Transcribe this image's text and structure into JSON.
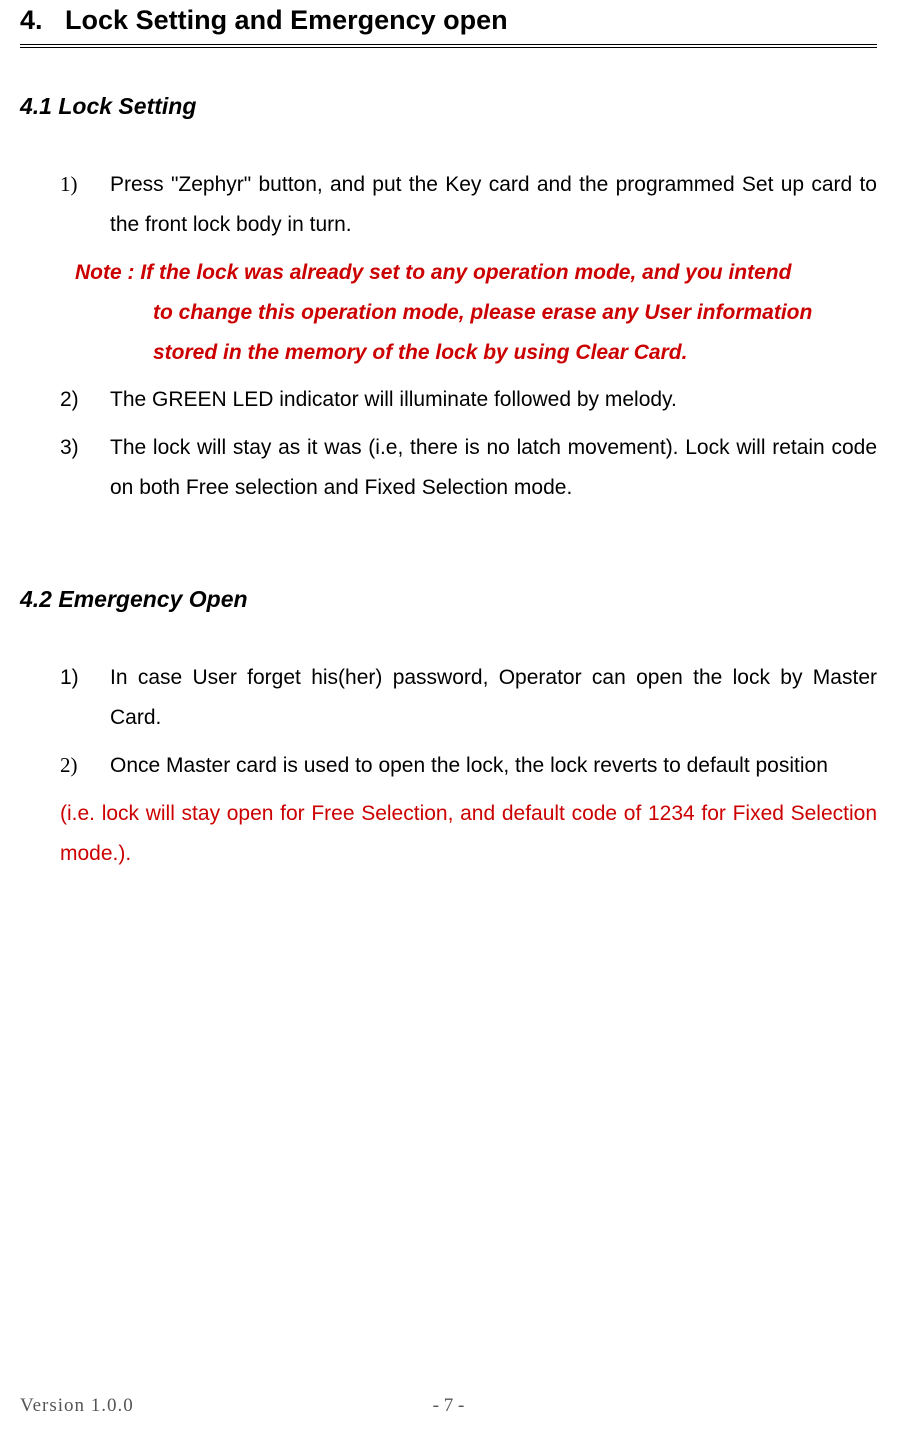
{
  "chapter": {
    "number": "4.",
    "title": "Lock Setting and Emergency open"
  },
  "section_41": {
    "title": "4.1 Lock Setting",
    "item1_num": "1)",
    "item1_text": "Press \"Zephyr\" button, and put the Key card and the programmed Set up card to the front lock body in turn.",
    "note_label": "Note : ",
    "note_line1": "If the lock was already set to any operation mode, and you intend",
    "note_line2": "to change this operation mode, please erase any User information",
    "note_line3": "stored in the memory of the lock by using Clear Card.",
    "item2_num": "2)",
    "item2_text": "The GREEN LED indicator will illuminate followed by melody.",
    "item3_num": "3)",
    "item3_text": "The lock will stay as it was (i.e, there is no latch movement). Lock will retain code on both Free selection and Fixed Selection mode."
  },
  "section_42": {
    "title": "4.2 Emergency Open",
    "item1_num": "1)",
    "item1_text": "In case User forget his(her) password, Operator can open the lock by Master Card.",
    "item2_num": "2)",
    "item2_text": "Once Master card is used to open the lock, the lock reverts to default position",
    "red_note": "(i.e. lock will stay open for Free Selection, and default code of 1234 for Fixed Selection mode.)."
  },
  "footer": {
    "version": "Version 1.0.0",
    "page": "- 7 -"
  }
}
